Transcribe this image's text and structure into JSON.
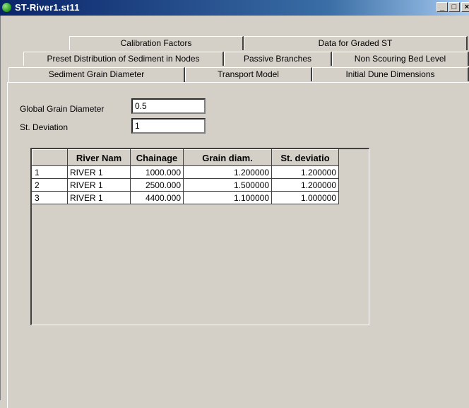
{
  "window": {
    "title": "ST-River1.st11",
    "minimize_label": "_",
    "maximize_label": "□",
    "close_label": "×"
  },
  "tabs": {
    "row1": [
      "Calibration Factors",
      "Data for Graded ST"
    ],
    "row2": [
      "Preset Distribution of Sediment in Nodes",
      "Passive Branches",
      "Non Scouring Bed Level"
    ],
    "row3": [
      "Sediment Grain Diameter",
      "Transport Model",
      "Initial Dune Dimensions"
    ],
    "active": "Sediment Grain Diameter"
  },
  "form": {
    "global_grain_label": "Global Grain Diameter",
    "global_grain_value": "0.5",
    "std_dev_label": "St. Deviation",
    "std_dev_value": "1"
  },
  "table": {
    "columns": [
      "",
      "River Nam",
      "Chainage",
      "Grain diam.",
      "St. deviatio"
    ],
    "rows": [
      {
        "num": "1",
        "river": "RIVER 1",
        "chainage": "1000.000",
        "grain": "1.200000",
        "std": "1.200000"
      },
      {
        "num": "2",
        "river": "RIVER 1",
        "chainage": "2500.000",
        "grain": "1.500000",
        "std": "1.200000"
      },
      {
        "num": "3",
        "river": "RIVER 1",
        "chainage": "4400.000",
        "grain": "1.100000",
        "std": "1.000000"
      }
    ]
  }
}
